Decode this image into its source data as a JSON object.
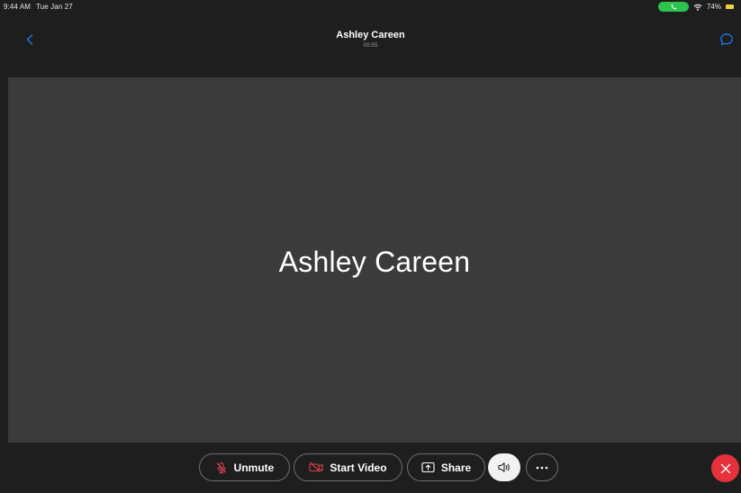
{
  "status": {
    "time": "9:44 AM",
    "date": "Tue Jan 27",
    "battery_percent": "74%"
  },
  "header": {
    "title": "Ashley Careen",
    "duration": "00:55"
  },
  "stage": {
    "participant_name": "Ashley Careen"
  },
  "controls": {
    "unmute_label": "Unmute",
    "start_video_label": "Start Video",
    "share_label": "Share"
  },
  "icons": {
    "back": "chevron-left-icon",
    "chat": "chat-bubble-icon",
    "mute": "mic-off-icon",
    "video": "video-off-icon",
    "share": "share-screen-icon",
    "audio": "speaker-icon",
    "more": "more-icon",
    "end": "close-icon"
  },
  "colors": {
    "accent_blue": "#1e7df0",
    "end_call_red": "#e5313b",
    "muted_red": "#e0434b",
    "call_green": "#2cc44c",
    "battery_yellow": "#f4d03f",
    "stage_bg": "#3b3b3b",
    "app_bg": "#1e1e1e"
  }
}
